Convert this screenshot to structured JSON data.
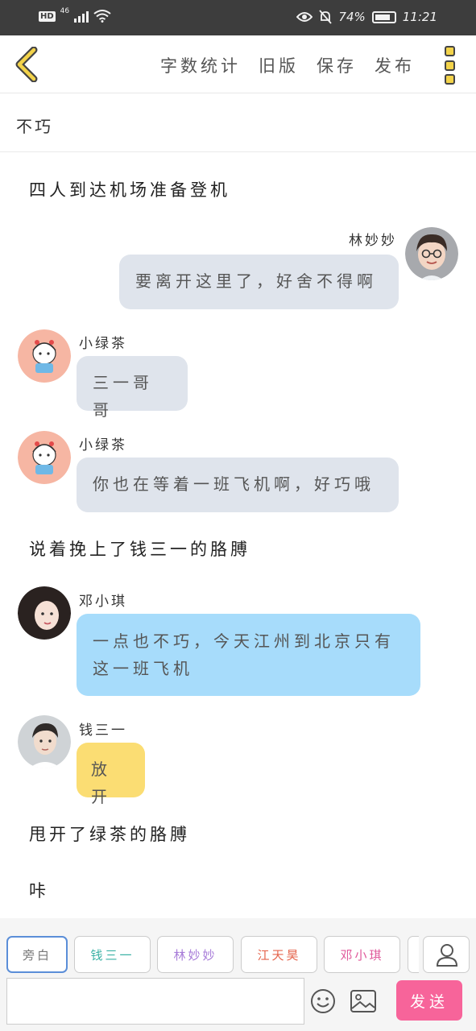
{
  "status_bar": {
    "hd": "HD",
    "network": "46",
    "battery_text": "74%",
    "time": "11:21"
  },
  "toolbar": {
    "actions": [
      "字数统计",
      "旧版",
      "保存",
      "发布"
    ]
  },
  "title": "不巧",
  "messages": [
    {
      "type": "narration",
      "text": "四人到达机场准备登机"
    },
    {
      "type": "chat",
      "side": "right",
      "speaker": "林妙妙",
      "text": "要离开这里了，好舍不得啊",
      "bubble_color": "#dfe4ec"
    },
    {
      "type": "chat",
      "side": "left",
      "speaker": "小绿茶",
      "text": "三一哥哥",
      "bubble_color": "#dfe4ec"
    },
    {
      "type": "chat",
      "side": "left",
      "speaker": "小绿茶",
      "text": "你也在等着一班飞机啊，好巧哦",
      "bubble_color": "#dfe4ec"
    },
    {
      "type": "narration",
      "text": "说着挽上了钱三一的胳膊"
    },
    {
      "type": "chat",
      "side": "left",
      "speaker": "邓小琪",
      "text": "一点也不巧，今天江州到北京只有这一班飞机",
      "bubble_color": "#a7dcfb"
    },
    {
      "type": "chat",
      "side": "left",
      "speaker": "钱三一",
      "text": "放开",
      "bubble_color": "#fbdd73"
    },
    {
      "type": "narration",
      "text": "甩开了绿茶的胳膊"
    },
    {
      "type": "narration",
      "text": "咔"
    }
  ],
  "roles": [
    {
      "label": "旁白",
      "color": "#777777",
      "active": true
    },
    {
      "label": "钱三一",
      "color": "#3bb2a5",
      "active": false
    },
    {
      "label": "林妙妙",
      "color": "#a77bd8",
      "active": false
    },
    {
      "label": "江天昊",
      "color": "#e5654d",
      "active": false
    },
    {
      "label": "邓小琪",
      "color": "#e0589a",
      "active": false
    }
  ],
  "input": {
    "value": "",
    "placeholder": ""
  },
  "send_label": "发送",
  "icons": {
    "back": "chevron-left-icon",
    "more": "more-vertical-icon",
    "role_picker": "person-icon",
    "emoji": "emoji-icon",
    "image": "image-icon"
  },
  "colors": {
    "accent_yellow": "#f3d34a",
    "send_pink": "#f7649a",
    "active_role_border": "#5b8ed8"
  }
}
